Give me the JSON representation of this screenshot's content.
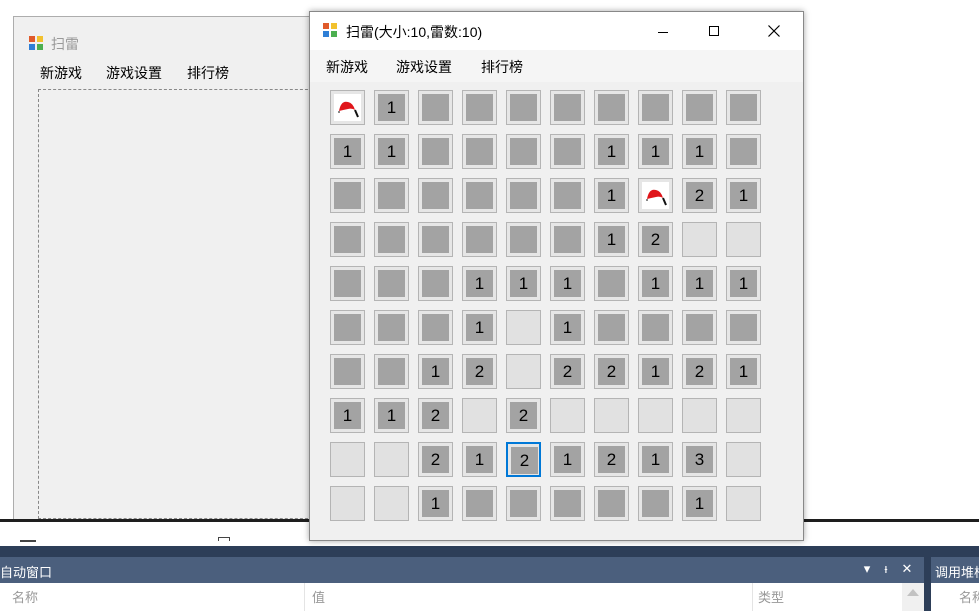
{
  "bg_window": {
    "title": "扫雷",
    "menu": [
      "新游戏",
      "游戏设置",
      "排行榜"
    ]
  },
  "game_window": {
    "title": "扫雷(大小:10,雷数:10)",
    "menu": [
      "新游戏",
      "游戏设置",
      "排行榜"
    ],
    "controls": {
      "minimize": "minimize-icon",
      "maximize": "maximize-icon",
      "close": "close-icon"
    },
    "board": {
      "rows": 10,
      "cols": 10,
      "legend": {
        "H": "hidden",
        "O": "opened-empty",
        "F": "flag",
        "1-8": "opened-number"
      },
      "cells": [
        [
          "F",
          "1",
          "H",
          "H",
          "H",
          "H",
          "H",
          "H",
          "H",
          "H"
        ],
        [
          "1",
          "1",
          "H",
          "H",
          "H",
          "H",
          "1",
          "1",
          "1",
          "H"
        ],
        [
          "H",
          "H",
          "H",
          "H",
          "H",
          "H",
          "1",
          "F",
          "2",
          "1"
        ],
        [
          "H",
          "H",
          "H",
          "H",
          "H",
          "H",
          "1",
          "2",
          "O",
          "O"
        ],
        [
          "H",
          "H",
          "H",
          "1",
          "1",
          "1",
          "H",
          "1",
          "1",
          "1"
        ],
        [
          "H",
          "H",
          "H",
          "1",
          "O",
          "1",
          "H",
          "H",
          "H",
          "H"
        ],
        [
          "H",
          "H",
          "1",
          "2",
          "O",
          "2",
          "2",
          "1",
          "2",
          "1"
        ],
        [
          "1",
          "1",
          "2",
          "O",
          "2",
          "O",
          "O",
          "O",
          "O",
          "O"
        ],
        [
          "O",
          "O",
          "2",
          "1",
          "2",
          "1",
          "2",
          "1",
          "3",
          "O"
        ],
        [
          "O",
          "O",
          "1",
          "H",
          "H",
          "H",
          "H",
          "H",
          "1",
          "O"
        ]
      ],
      "focused_cell": {
        "row": 8,
        "col": 4
      }
    }
  },
  "autos_panel": {
    "title": "自动窗口",
    "header_buttons": [
      "▾",
      "ᵻ",
      "✕"
    ],
    "columns": [
      "名称",
      "值",
      "类型"
    ]
  },
  "callstack_panel": {
    "title": "调用堆栈",
    "columns": [
      "名称"
    ]
  },
  "colors": {
    "hidden_cell": "#a3a3a3",
    "cell_border": "#b4b4b4",
    "panel_header": "#4b5f7d",
    "focus": "#0078d7",
    "flag_red": "#e0151a"
  }
}
